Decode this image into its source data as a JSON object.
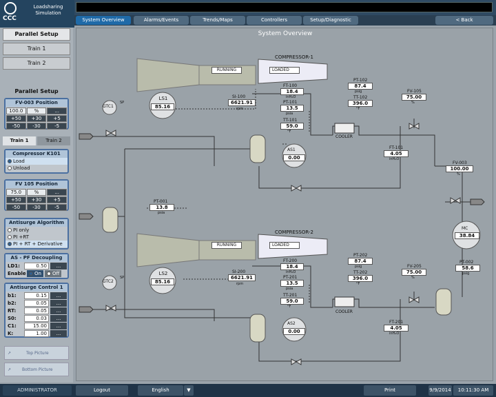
{
  "app": {
    "logo": "CCC",
    "title": "Loadsharing Simulation"
  },
  "tabs": [
    "System Overview",
    "Alarms/Events",
    "Trends/Maps",
    "Controllers",
    "Setup/Diagnostic"
  ],
  "back_label": "<  Back",
  "sidebar": {
    "buttons": [
      "Parallel Setup",
      "Train 1",
      "Train 2"
    ],
    "parallel_setup": {
      "title": "Parallel Setup",
      "fv003": {
        "title": "FV-003 Position",
        "value": "100.0",
        "unit": "%",
        "row2": [
          "+50",
          "+30",
          "+5"
        ],
        "row3": [
          "-50",
          "-30",
          "-5"
        ]
      }
    },
    "train_tabs": [
      "Train 1",
      "Train 2"
    ],
    "compressor": {
      "title": "Compressor K101",
      "options": [
        "Load",
        "Unload"
      ]
    },
    "fv105": {
      "title": "FV 105 Position",
      "value": "75.0",
      "unit": "%",
      "row2": [
        "+50",
        "+30",
        "+5"
      ],
      "row3": [
        "-50",
        "-30",
        "-5"
      ]
    },
    "antisurge_alg": {
      "title": "Antisurge Algorithm",
      "options": [
        "PI only",
        "PI +RT",
        "PI + RT + Derivative"
      ]
    },
    "decoupling": {
      "title": "AS - PF Decoupling",
      "ld1_label": "LD1:",
      "ld1_value": "0.50",
      "enable_label": "Enable",
      "on": "On",
      "off": "Off"
    },
    "control": {
      "title": "Antisurge Control 1",
      "rows": [
        {
          "l": "b1:",
          "v": "0.15"
        },
        {
          "l": "b2:",
          "v": "0.05"
        },
        {
          "l": "RT:",
          "v": "0.05"
        },
        {
          "l": "S0:",
          "v": "0.03"
        },
        {
          "l": "C1:",
          "v": "15.00"
        },
        {
          "l": "K:",
          "v": "1.00"
        }
      ]
    },
    "picture": {
      "top": "Top Picture",
      "bottom": "Bottom Picture"
    }
  },
  "main": {
    "title": "System Overview",
    "train1": {
      "compressor": "COMPRESSOR-1",
      "running": "RUNNING",
      "loaded": "LOADED",
      "ls": "LS1",
      "ls_value": "85.16",
      "gtc": "GTC1",
      "sp": "SP",
      "si": "SI-100",
      "si_value": "6621.91",
      "si_unit": "rpm",
      "ft": "FT-100",
      "ft_value": "18.4",
      "ft_unit": "inH₂O",
      "pt_in": "PT-101",
      "pt_in_value": "13.5",
      "pt_in_unit": "psia",
      "tt_in": "TT-101",
      "tt_in_value": "59.0",
      "tt_in_unit": "°F",
      "pt_out": "PT-102",
      "pt_out_value": "87.4",
      "pt_out_unit": "psig",
      "tt_out": "TT-102",
      "tt_out_value": "396.0",
      "tt_out_unit": "°F",
      "fv": "FV-105",
      "fv_value": "75.00",
      "fv_unit": "%",
      "cooler": "COOLER",
      "ft2": "FT-101",
      "ft2_value": "4.05",
      "ft2_unit": "inH₂O",
      "as": "AS1",
      "as_value": "0.00"
    },
    "train2": {
      "compressor": "COMPRESSOR-2",
      "running": "RUNNING",
      "loaded": "LOADED",
      "ls": "LS2",
      "ls_value": "85.16",
      "gtc": "GTC2",
      "sp": "SP",
      "si": "SI-200",
      "si_value": "6621.91",
      "si_unit": "rpm",
      "ft": "FT-200",
      "ft_value": "18.4",
      "ft_unit": "inH₂O",
      "pt_in": "PT-201",
      "pt_in_value": "13.5",
      "pt_in_unit": "psia",
      "tt_in": "TT-201",
      "tt_in_value": "59.0",
      "tt_in_unit": "°F",
      "pt_out": "PT-202",
      "pt_out_value": "87.4",
      "pt_out_unit": "psig",
      "tt_out": "TT-202",
      "tt_out_value": "396.0",
      "tt_out_unit": "°F",
      "fv": "FV-205",
      "fv_value": "75.00",
      "fv_unit": "%",
      "cooler": "COOLER",
      "ft2": "FT-201",
      "ft2_value": "4.05",
      "ft2_unit": "inH₂O",
      "as": "AS2",
      "as_value": "0.00"
    },
    "common": {
      "pt001": "PT-001",
      "pt001_value": "13.8",
      "pt001_unit": "psia",
      "fv003": "FV-003",
      "fv003_value": "100.00",
      "fv003_unit": "%",
      "mc": "MC",
      "mc_value": "38.84",
      "pt002": "PT-002",
      "pt002_value": "58.6",
      "pt002_unit": "psig"
    }
  },
  "bottom": {
    "user": "ADMINISTRATOR",
    "logout": "Logout",
    "language": "English",
    "print": "Print",
    "date": "9/9/2014",
    "time": "10:11:30 AM"
  }
}
